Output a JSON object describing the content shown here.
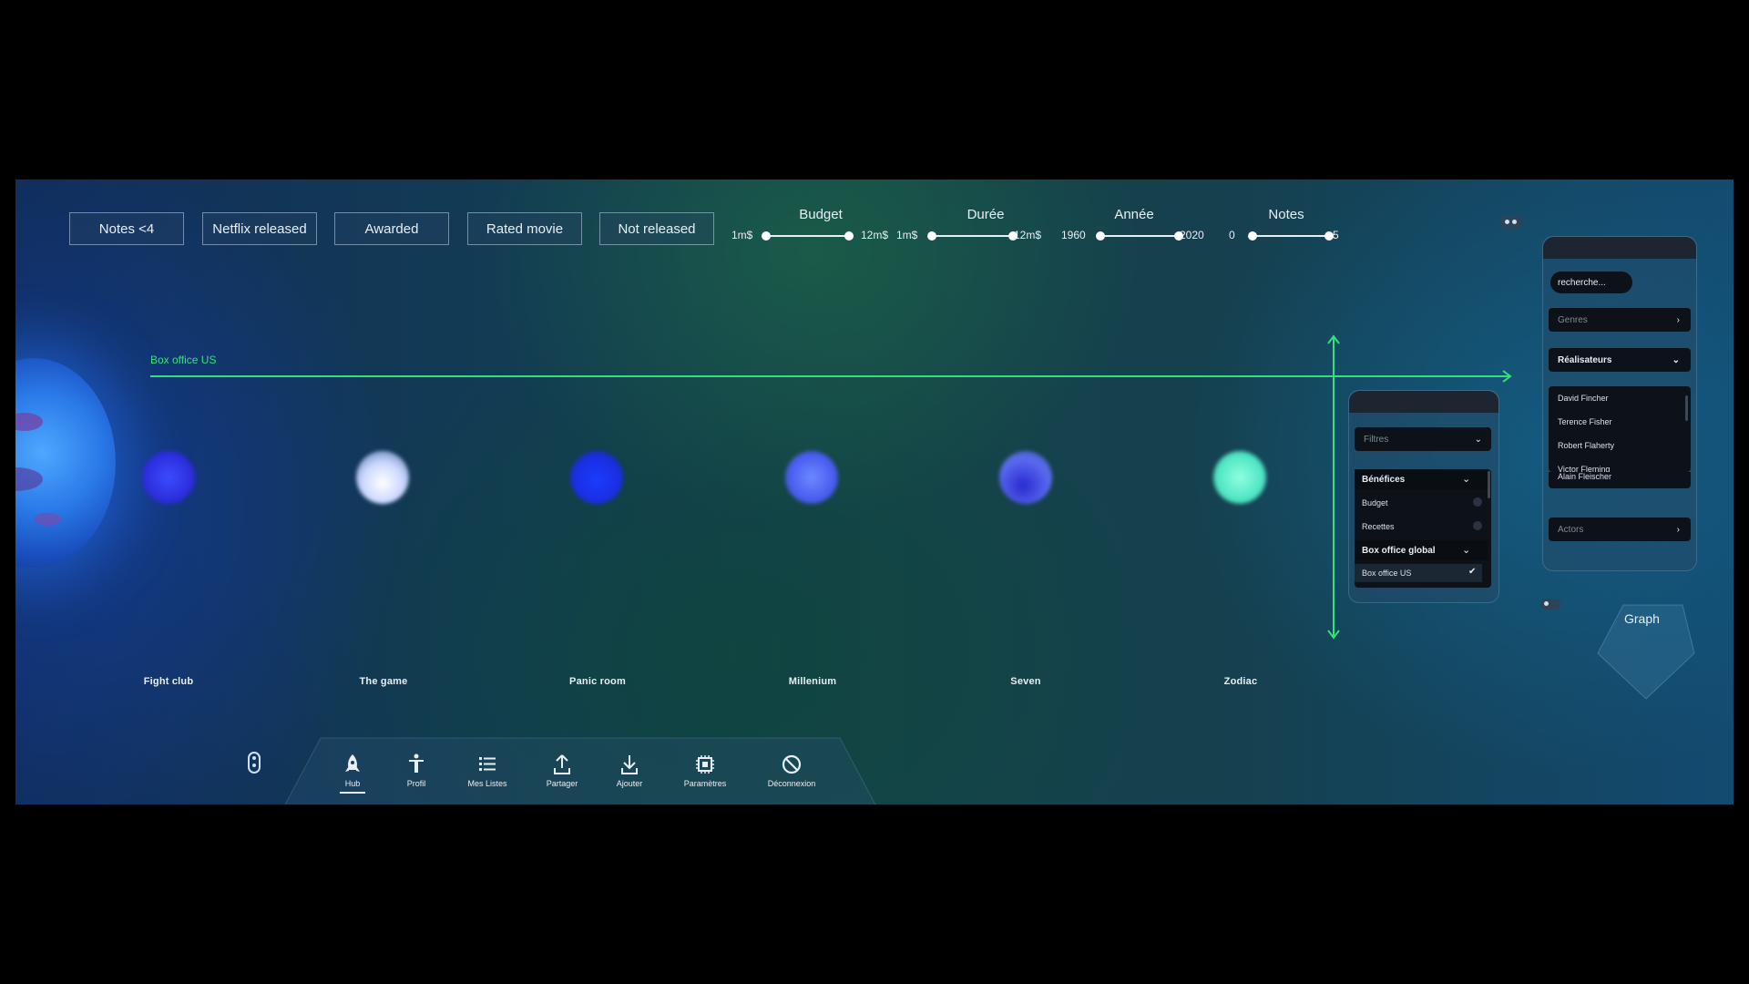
{
  "filters": {
    "chips": [
      "Notes <4",
      "Netflix released",
      "Awarded",
      "Rated movie",
      "Not released"
    ],
    "sliders": [
      {
        "title": "Budget",
        "min_label": "1m$",
        "max_label": "12m$"
      },
      {
        "title": "Durée",
        "min_label": "1m$",
        "max_label": "12m$"
      },
      {
        "title": "Année",
        "min_label": "1960",
        "max_label": "2020"
      },
      {
        "title": "Notes",
        "min_label": "0",
        "max_label": "5"
      }
    ]
  },
  "axis": {
    "x_label": "Box office US"
  },
  "movies": [
    "Fight club",
    "The game",
    "Panic room",
    "Millenium",
    "Seven",
    "Zodiac"
  ],
  "filter_panel": {
    "dropdown": "Filtres",
    "section1": "Bénéfices",
    "section1_items": [
      "Budget",
      "Recettes"
    ],
    "section2": "Box office global",
    "section2_items": [
      "Box office US"
    ]
  },
  "search_panel": {
    "search_placeholder": "recherche...",
    "genres": "Genres",
    "realisateurs": "Réalisateurs",
    "directors": [
      "David Fincher",
      "Terence Fisher",
      "Robert Flaherty",
      "Victor Fleming",
      "Alain Fleischer"
    ],
    "actors": "Actors"
  },
  "graph_label": "Graph",
  "nav": {
    "items": [
      "Hub",
      "Profil",
      "Mes Listes",
      "Partager",
      "Ajouter",
      "Paramètres",
      "Déconnexion"
    ],
    "active": "Hub"
  },
  "colors": {
    "axis": "#33e07a",
    "accent_blue": "#2a3cff",
    "accent_teal": "#5ff0c8"
  }
}
